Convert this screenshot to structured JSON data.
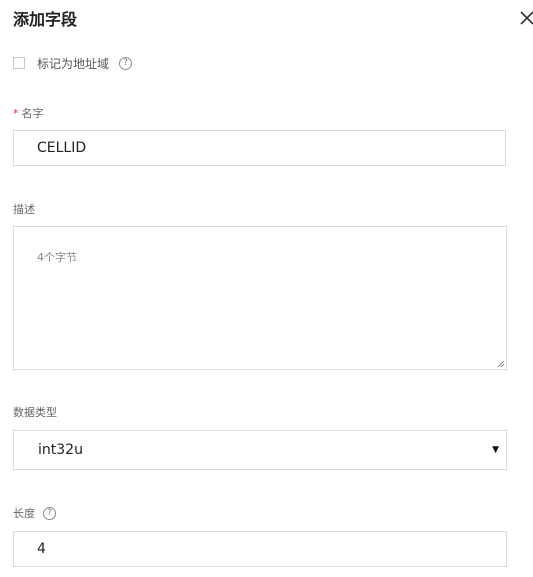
{
  "dialog": {
    "title": "添加字段"
  },
  "address_field": {
    "label": "标记为地址域",
    "checked": false
  },
  "name": {
    "required_mark": "*",
    "label": "名字",
    "value": "CELLID"
  },
  "description": {
    "label": "描述",
    "placeholder": "4个字节",
    "value": ""
  },
  "data_type": {
    "label": "数据类型",
    "selected": "int32u"
  },
  "length": {
    "label": "长度",
    "value": "4"
  },
  "help_glyph": "?"
}
